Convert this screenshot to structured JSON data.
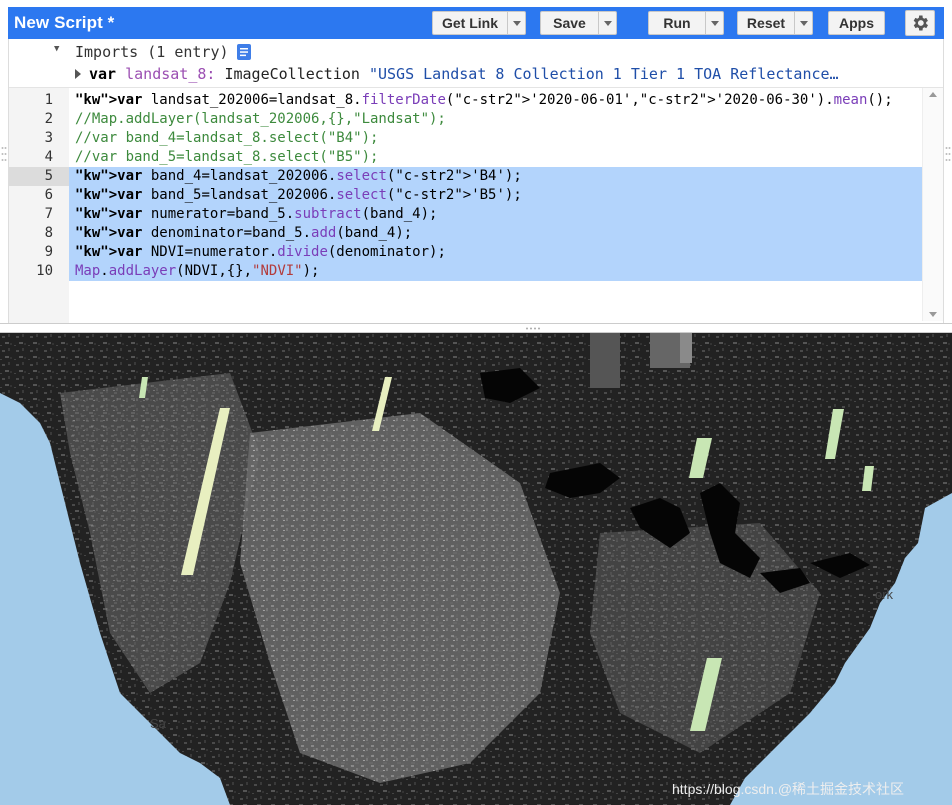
{
  "header": {
    "title": "New Script *",
    "buttons": {
      "get_link": "Get Link",
      "save": "Save",
      "run": "Run",
      "reset": "Reset",
      "apps": "Apps"
    }
  },
  "imports": {
    "label": "Imports (1 entry)",
    "entry": {
      "keyword": "var",
      "name": "landsat_8:",
      "type": "ImageCollection",
      "description": "\"USGS Landsat 8 Collection 1 Tier 1 TOA Reflectance…"
    }
  },
  "editor": {
    "line_numbers": [
      "1",
      "2",
      "3",
      "4",
      "5",
      "6",
      "7",
      "8",
      "9",
      "10"
    ],
    "highlighted_lines": [
      5,
      6,
      7,
      8,
      9,
      10
    ],
    "code": [
      "var landsat_202006=landsat_8.filterDate('2020-06-01','2020-06-30').mean();",
      "//Map.addLayer(landsat_202006,{},\"Landsat\");",
      "//var band_4=landsat_8.select(\"B4\");",
      "//var band_5=landsat_8.select(\"B5\");",
      "var band_4=landsat_202006.select('B4');",
      "var band_5=landsat_202006.select('B5');",
      "var numerator=band_5.subtract(band_4);",
      "var denominator=band_5.add(band_4);",
      "var NDVI=numerator.divide(denominator);",
      "Map.addLayer(NDVI,{},\"NDVI\");"
    ]
  },
  "map": {
    "labels": {
      "ork": "ork",
      "sa": "Sa"
    },
    "watermark": "https://blog.csdn.@稀土掘金技术社区",
    "colors": {
      "water": "#a3cbe9",
      "land_dark": "#1a1a1a",
      "swath_green": "#c8e6b4"
    }
  },
  "colors": {
    "header_bg": "#2c78f0",
    "selection": "#b3d4fc"
  },
  "icons": {
    "settings": "gear-icon",
    "dropdown": "chevron-down-icon",
    "imports": "document-icon"
  }
}
